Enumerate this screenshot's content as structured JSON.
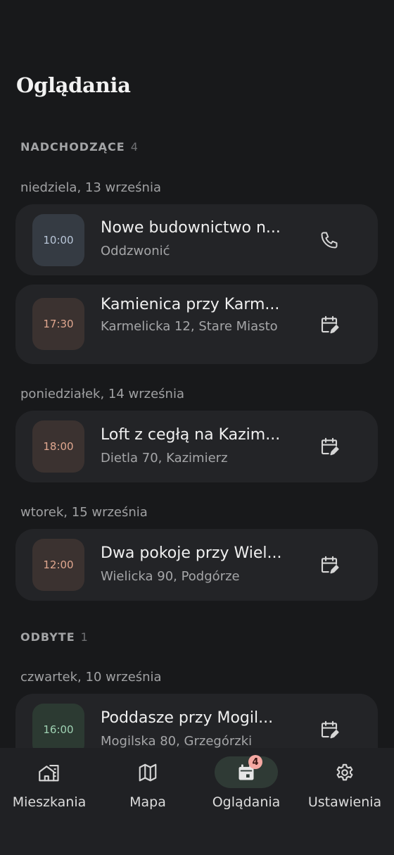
{
  "page": {
    "title": "Oglądania"
  },
  "sections": {
    "upcoming": {
      "label": "NADCHODZĄCE",
      "count": "4"
    },
    "past": {
      "label": "ODBYTE",
      "count": "1"
    }
  },
  "dates": {
    "d1": "niedziela, 13 września",
    "d2": "poniedziałek, 14 września",
    "d3": "wtorek, 15 września",
    "d4": "czwartek, 10 września"
  },
  "viewings": [
    {
      "time": "10:00",
      "title": "Nowe budownictwo n...",
      "subtitle": "Oddzwonić",
      "action_icon": "phone-icon",
      "time_bg": "#353b43",
      "time_color": "#b9c6d8"
    },
    {
      "time": "17:30",
      "title": "Kamienica przy Karm...",
      "subtitle": "Karmelicka 12, Stare Miasto",
      "action_icon": "calendar-edit-icon",
      "time_bg": "#3b3230",
      "time_color": "#e0a78f"
    },
    {
      "time": "18:00",
      "title": "Loft z cegłą na Kazim...",
      "subtitle": "Dietla 70, Kazimierz",
      "action_icon": "calendar-edit-icon",
      "time_bg": "#3b3230",
      "time_color": "#e0a78f"
    },
    {
      "time": "12:00",
      "title": "Dwa pokoje przy Wiel...",
      "subtitle": "Wielicka 90, Podgórze",
      "action_icon": "calendar-edit-icon",
      "time_bg": "#3b3230",
      "time_color": "#e0a78f"
    },
    {
      "time": "16:00",
      "title": "Poddasze przy Mogil...",
      "subtitle": "Mogilska 80, Grzegórzki",
      "action_icon": "calendar-edit-icon",
      "time_bg": "#2c3a32",
      "time_color": "#9fd2b3"
    }
  ],
  "nav": {
    "items": [
      {
        "label": "Mieszkania",
        "icon": "building-icon"
      },
      {
        "label": "Mapa",
        "icon": "map-icon"
      },
      {
        "label": "Oglądania",
        "icon": "calendar-icon",
        "badge": "4",
        "active": true
      },
      {
        "label": "Ustawienia",
        "icon": "gear-icon"
      }
    ]
  },
  "colors": {
    "background": "#18191b",
    "card": "#232427",
    "nav_active": "#2f3a35",
    "badge": "#f4a8a2"
  }
}
